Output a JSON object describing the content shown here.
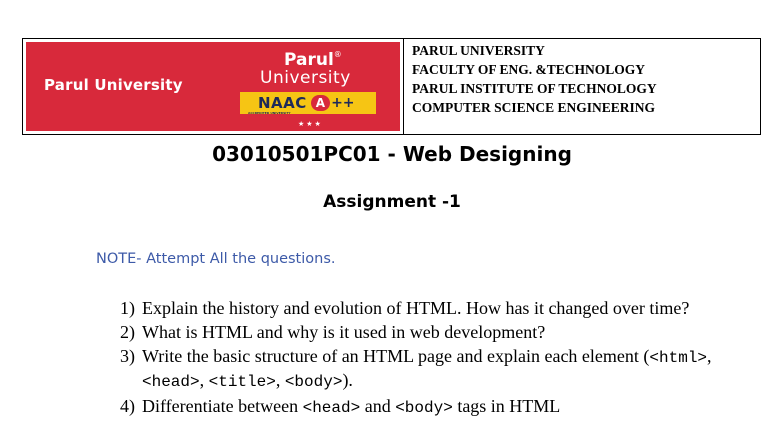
{
  "header": {
    "logo": {
      "left_text": "Parul University",
      "brand": "Parul",
      "brand_sub": "University",
      "naac": "NAAC",
      "grade": "A",
      "grade_plus": "++",
      "naac_sub": "ACCREDITED UNIVERSITY",
      "stars": "★★★",
      "bg_color": "#d8293b",
      "naac_color": "#f6c514"
    },
    "lines": [
      "PARUL UNIVERSITY",
      "FACULTY OF ENG. &TECHNOLOGY",
      "PARUL INSTITUTE OF TECHNOLOGY",
      "COMPUTER SCIENCE ENGINEERING"
    ]
  },
  "course_title": "03010501PC01 - Web Designing",
  "assignment_title": "Assignment -1",
  "note": "NOTE- Attempt All the questions.",
  "note_color": "#3d5aa8",
  "questions": [
    {
      "num": "1)",
      "text": "Explain the history and evolution of HTML. How has it changed over time?"
    },
    {
      "num": "2)",
      "text": "What is HTML and why is it used in web development?"
    },
    {
      "num": "3)",
      "text_a": "Write the basic structure of an HTML page and explain each element (",
      "tag1": "<html>",
      "sep1": ", ",
      "tag2": "<head>",
      "sep2": ", ",
      "tag3": "<title>",
      "sep3": ", ",
      "tag4": "<body>",
      "text_b": ")."
    },
    {
      "num": "4)",
      "text_a": "Differentiate between ",
      "tag1": "<head>",
      "mid": " and ",
      "tag2": "<body>",
      "text_b": " tags in HTML"
    }
  ]
}
